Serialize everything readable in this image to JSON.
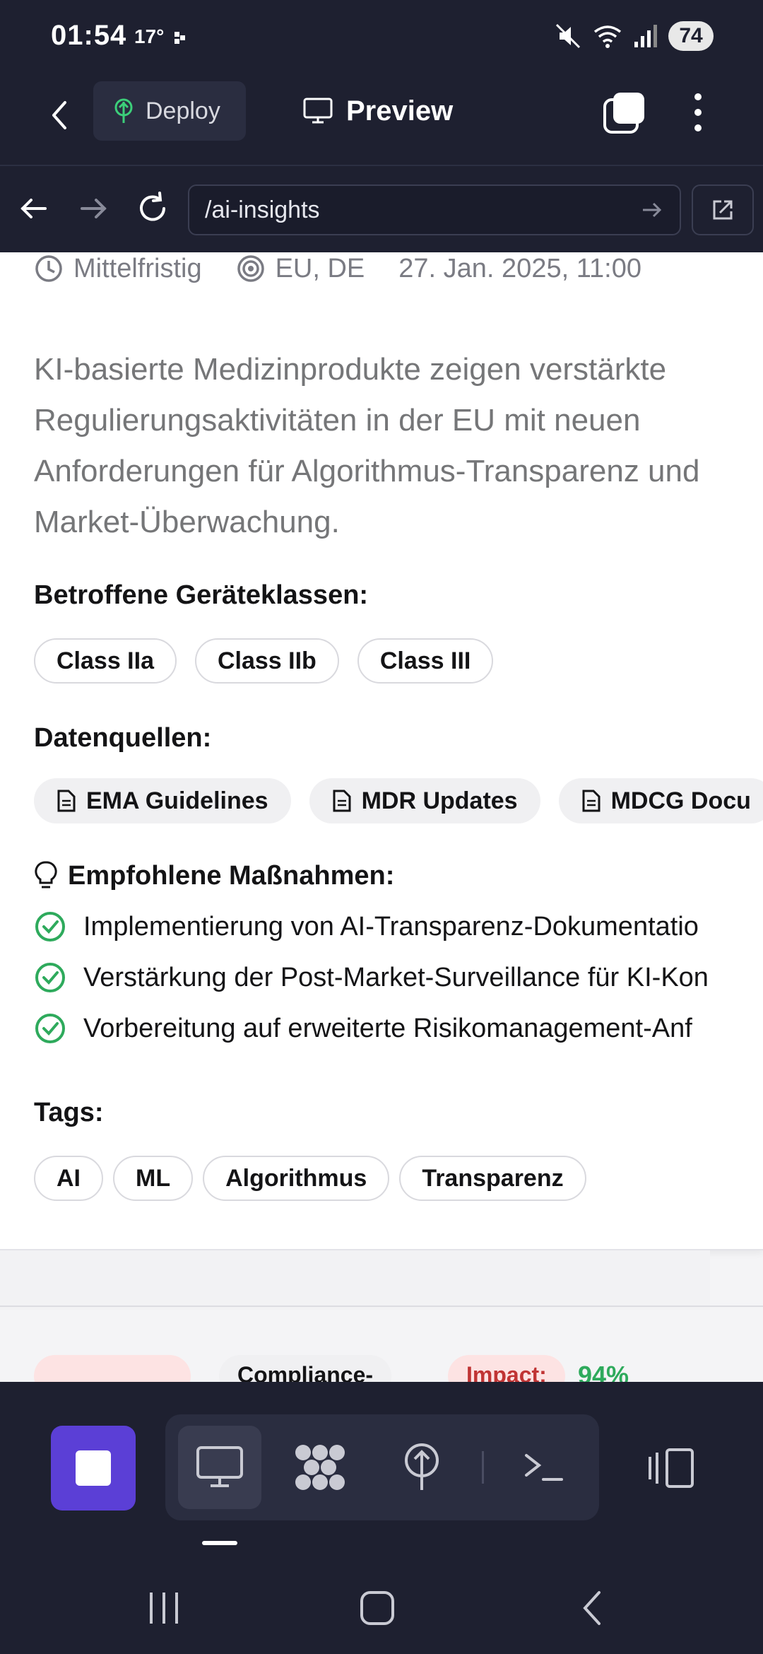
{
  "status": {
    "time": "01:54",
    "temp": "17°",
    "battery": "74"
  },
  "toolbar": {
    "deploy_label": "Deploy",
    "preview_label": "Preview"
  },
  "urlbar": {
    "url": "/ai-insights"
  },
  "insight": {
    "timeframe": "Mittelfristig",
    "regions": "EU, DE",
    "date": "27. Jan. 2025, 11:00",
    "description_lines": [
      "KI-basierte Medizinprodukte zeigen verstärkte",
      "Regulierungsaktivitäten in der EU mit neuen",
      "Anforderungen für Algorithmus-Transparenz und",
      "Market-Überwachung."
    ],
    "device_classes_label": "Betroffene Geräteklassen:",
    "device_classes": [
      "Class IIa",
      "Class IIb",
      "Class III"
    ],
    "sources_label": "Datenquellen:",
    "sources": [
      "EMA Guidelines",
      "MDR Updates",
      "MDCG Docu"
    ],
    "actions_label": "Empfohlene Maßnahmen:",
    "actions": [
      "Implementierung von AI-Transparenz-Dokumentatio",
      "Verstärkung der Post-Market-Surveillance für KI-Kon",
      "Vorbereitung auf erweiterte Risikomanagement-Anf"
    ],
    "tags_label": "Tags:",
    "tags": [
      "AI",
      "ML",
      "Algorithmus",
      "Transparenz"
    ]
  },
  "next_card_peek": {
    "chip_compliance": "Compliance-",
    "chip_impact": "Impact:",
    "score": "94%"
  },
  "colors": {
    "accent": "#5b3fd6",
    "success": "#2eaa5c",
    "deploy_icon": "#3ccf7a",
    "impact_bg": "#fde3e3",
    "impact_text": "#c03434"
  }
}
